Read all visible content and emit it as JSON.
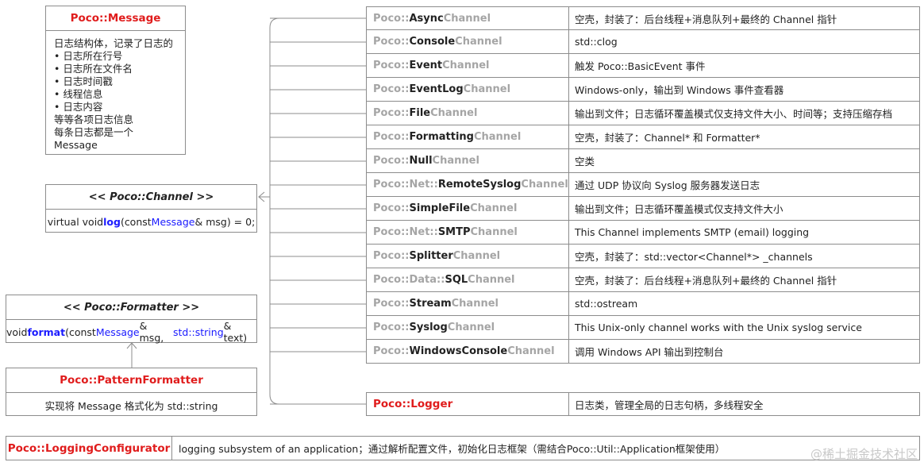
{
  "message": {
    "title": "Poco::Message",
    "lines": [
      "日志结构体，记录了日志的",
      "• 日志所在行号",
      "• 日志所在文件名",
      "• 日志时间戳",
      "• 线程信息",
      "• 日志内容",
      "等等各项日志信息",
      "每条日志都是一个 Message"
    ]
  },
  "channel": {
    "title": "<< Poco::Channel >>",
    "sig_pre": "virtual void ",
    "sig_fn": "log",
    "sig_open": "(const ",
    "sig_type": "Message",
    "sig_post": "& msg) = 0;"
  },
  "formatter": {
    "title": "<< Poco::Formatter >>",
    "sig_pre": "void ",
    "sig_fn": "format",
    "sig_open": "(const ",
    "sig_type": "Message",
    "sig_mid": "& msg, ",
    "sig_type2": "std::string",
    "sig_post": "& text)"
  },
  "pattern_formatter": {
    "title": "Poco::PatternFormatter",
    "desc": "实现将 Message 格式化为 std::string"
  },
  "channels": [
    {
      "pre": "Poco::",
      "mid": "Async",
      "post": "Channel",
      "desc": "空壳，封装了：后台线程+消息队列+最终的 Channel 指针"
    },
    {
      "pre": "Poco::",
      "mid": "Console",
      "post": "Channel",
      "desc": "std::clog"
    },
    {
      "pre": "Poco::",
      "mid": "Event",
      "post": "Channel",
      "desc": "触发 Poco::BasicEvent 事件"
    },
    {
      "pre": "Poco::",
      "mid": "EventLog",
      "post": "Channel",
      "desc": "Windows-only，输出到 Windows 事件查看器"
    },
    {
      "pre": "Poco::",
      "mid": "File",
      "post": "Channel",
      "desc": "输出到文件；日志循环覆盖模式仅支持文件大小、时间等；支持压缩存档"
    },
    {
      "pre": "Poco::",
      "mid": "Formatting",
      "post": "Channel",
      "desc": "空壳，封装了：Channel* 和 Formatter*"
    },
    {
      "pre": "Poco::",
      "mid": "Null",
      "post": "Channel",
      "desc": "空类"
    },
    {
      "pre": "Poco::Net::",
      "mid": "RemoteSyslog",
      "post": "Channel",
      "desc": "通过 UDP 协议向 Syslog 服务器发送日志"
    },
    {
      "pre": "Poco::",
      "mid": "SimpleFile",
      "post": "Channel",
      "desc": "输出到文件；日志循环覆盖模式仅支持文件大小"
    },
    {
      "pre": "Poco::Net::",
      "mid": "SMTP",
      "post": "Channel",
      "desc": "This Channel implements SMTP (email) logging"
    },
    {
      "pre": "Poco::",
      "mid": "Splitter",
      "post": "Channel",
      "desc": "空壳，封装了：std::vector<Channel*> _channels"
    },
    {
      "pre": "Poco::Data::",
      "mid": "SQL",
      "post": "Channel",
      "desc": "空壳，封装了：后台线程+消息队列+最终的 Channel 指针"
    },
    {
      "pre": "Poco::",
      "mid": "Stream",
      "post": "Channel",
      "desc": "std::ostream"
    },
    {
      "pre": "Poco::",
      "mid": "Syslog",
      "post": "Channel",
      "desc": "This Unix-only channel works with the Unix syslog service"
    },
    {
      "pre": "Poco::",
      "mid": "WindowsConsole",
      "post": "Channel",
      "desc": "调用 Windows API 输出到控制台"
    }
  ],
  "logger": {
    "name": "Poco::Logger",
    "desc": "日志类，管理全局的日志句柄，多线程安全"
  },
  "configurator": {
    "name": "Poco::LoggingConfigurator",
    "desc": "logging subsystem of an application；通过解析配置文件，初始化日志框架（需结合Poco::Util::Application框架使用）"
  },
  "watermark": "@稀土掘金技术社区",
  "colors": {
    "class_name": "#e01c1c",
    "keyword": "#1a1aff",
    "prefix_gray": "#a5a5a5",
    "border": "#8c8c8c"
  }
}
